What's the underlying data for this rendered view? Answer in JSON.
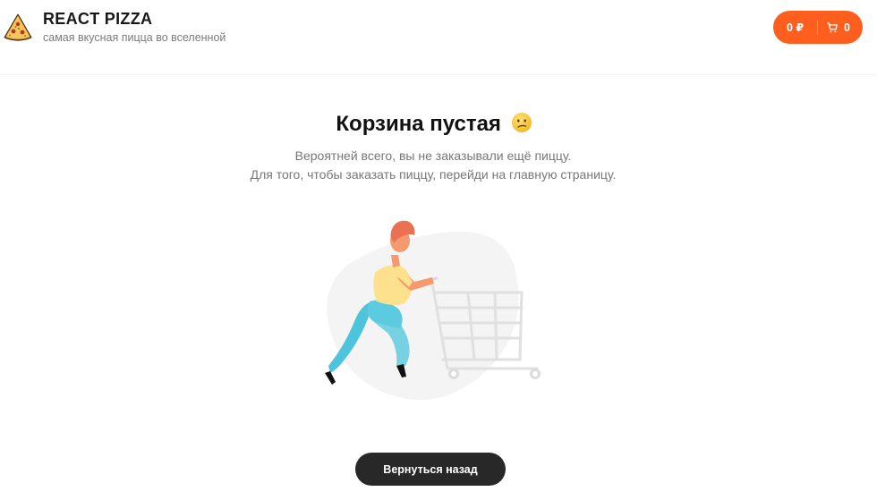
{
  "header": {
    "title": "REACT PIZZA",
    "subtitle": "самая вкусная пицца во вселенной",
    "logo_icon": "pizza-slice-icon",
    "cart": {
      "price": "0 ₽",
      "count": "0",
      "icon": "shopping-cart-icon",
      "color": "#fe5f1e"
    }
  },
  "empty_cart": {
    "title": "Корзина пустая",
    "emoji_icon": "confused-face-icon",
    "line1": "Вероятней всего, вы не заказывали ещё пиццу.",
    "line2": "Для того, чтобы заказать пиццу, перейди на главную страницу.",
    "illustration": "person-pushing-empty-cart-illustration",
    "back_button": "Вернуться назад",
    "back_button_color": "#282828"
  }
}
